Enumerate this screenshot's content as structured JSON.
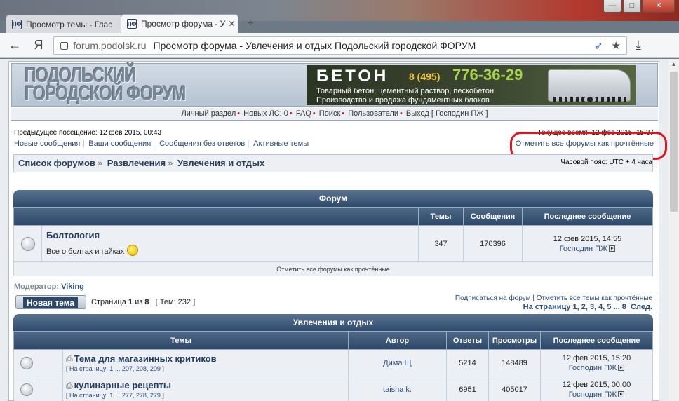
{
  "browser": {
    "window_controls": {
      "minimize": "—",
      "maximize": "□",
      "close": "✕"
    },
    "tabs": [
      {
        "title": "Просмотр темы - Глас"
      },
      {
        "title": "Просмотр форума - У"
      }
    ],
    "new_tab": "+",
    "back": "←",
    "yandex": "Я",
    "url_domain": "forum.podolsk.ru",
    "url_title": "Просмотр форума - Увлечения и отдых Подольский городской ФОРУМ",
    "star": "★",
    "download": "⤓"
  },
  "header": {
    "logo_line1": "ПОДОЛЬСКИЙ",
    "logo_line2": "ГОРОДСКОЙ ФОРУМ"
  },
  "banner": {
    "word": "БЕТОН",
    "code": "8 (495)",
    "phone": "776-36-29",
    "line1": "Товарный бетон, цементный раствор, пескобетон",
    "line2": "Производство и продажа фундаментных блоков"
  },
  "navbar": {
    "items": [
      "Личный раздел",
      "Новых ЛС: 0",
      "FAQ",
      "Поиск",
      "Пользователи",
      "Выход [ Господин ПЖ ]"
    ]
  },
  "info": {
    "last_visit": "Предыдущее посещение: 12 фев 2015, 00:43",
    "current_time": "Текущее время: 12 фев 2015, 15:37",
    "quick_links": [
      "Новые сообщения",
      "Ваши сообщения",
      "Сообщения без ответов",
      "Активные темы"
    ],
    "mark_all": "Отметить все форумы как прочтённые"
  },
  "breadcrumbs": [
    "Список форумов",
    "Развлечения",
    "Увлечения и отдых"
  ],
  "timezone": "Часовой пояс: UTC + 4 часа",
  "forum_table": {
    "title": "Форум",
    "columns": [
      "Темы",
      "Сообщения",
      "Последнее сообщение"
    ],
    "rows": [
      {
        "name": "Болтология",
        "desc": "Все о болтах и гайках",
        "topics": "347",
        "posts": "170396",
        "last_date": "12 фев 2015, 14:55",
        "last_author": "Господин ПЖ"
      }
    ],
    "mark_read": "Отметить все форумы как прочтённые"
  },
  "moderator": {
    "label": "Модератор:",
    "name": "Viking"
  },
  "new_topic_button": "Новая тема",
  "pagination": {
    "page_prefix": "Страница",
    "current": "1",
    "of": "из",
    "total": "8",
    "topics_count": "[ Тем: 232 ]",
    "subscribe": "Подписаться на форум",
    "mark_topics": "Отметить все темы как прочтённые",
    "goto_label": "На страницу",
    "pages_list": "1, 2, 3, 4, 5 ... 8",
    "next": "След."
  },
  "topics_table": {
    "title": "Увлечения и отдых",
    "columns": [
      "Темы",
      "Автор",
      "Ответы",
      "Просмотры",
      "Последнее сообщение"
    ],
    "rows": [
      {
        "title": "Тема для магазинных критиков",
        "pages": "На страницу: 1 ... 207, 208, 209",
        "author": "Дима Щ",
        "replies": "5214",
        "views": "148489",
        "last_date": "12 фев 2015, 15:20",
        "last_author": "Господин ПЖ"
      },
      {
        "title": "кулинарные рецепты",
        "pages": "На страницу: 1 ... 277, 278, 279",
        "author": "taisha k.",
        "replies": "6951",
        "views": "405017",
        "last_date": "12 фев 2015, 00:00",
        "last_author": "Господин ПЖ"
      }
    ]
  }
}
